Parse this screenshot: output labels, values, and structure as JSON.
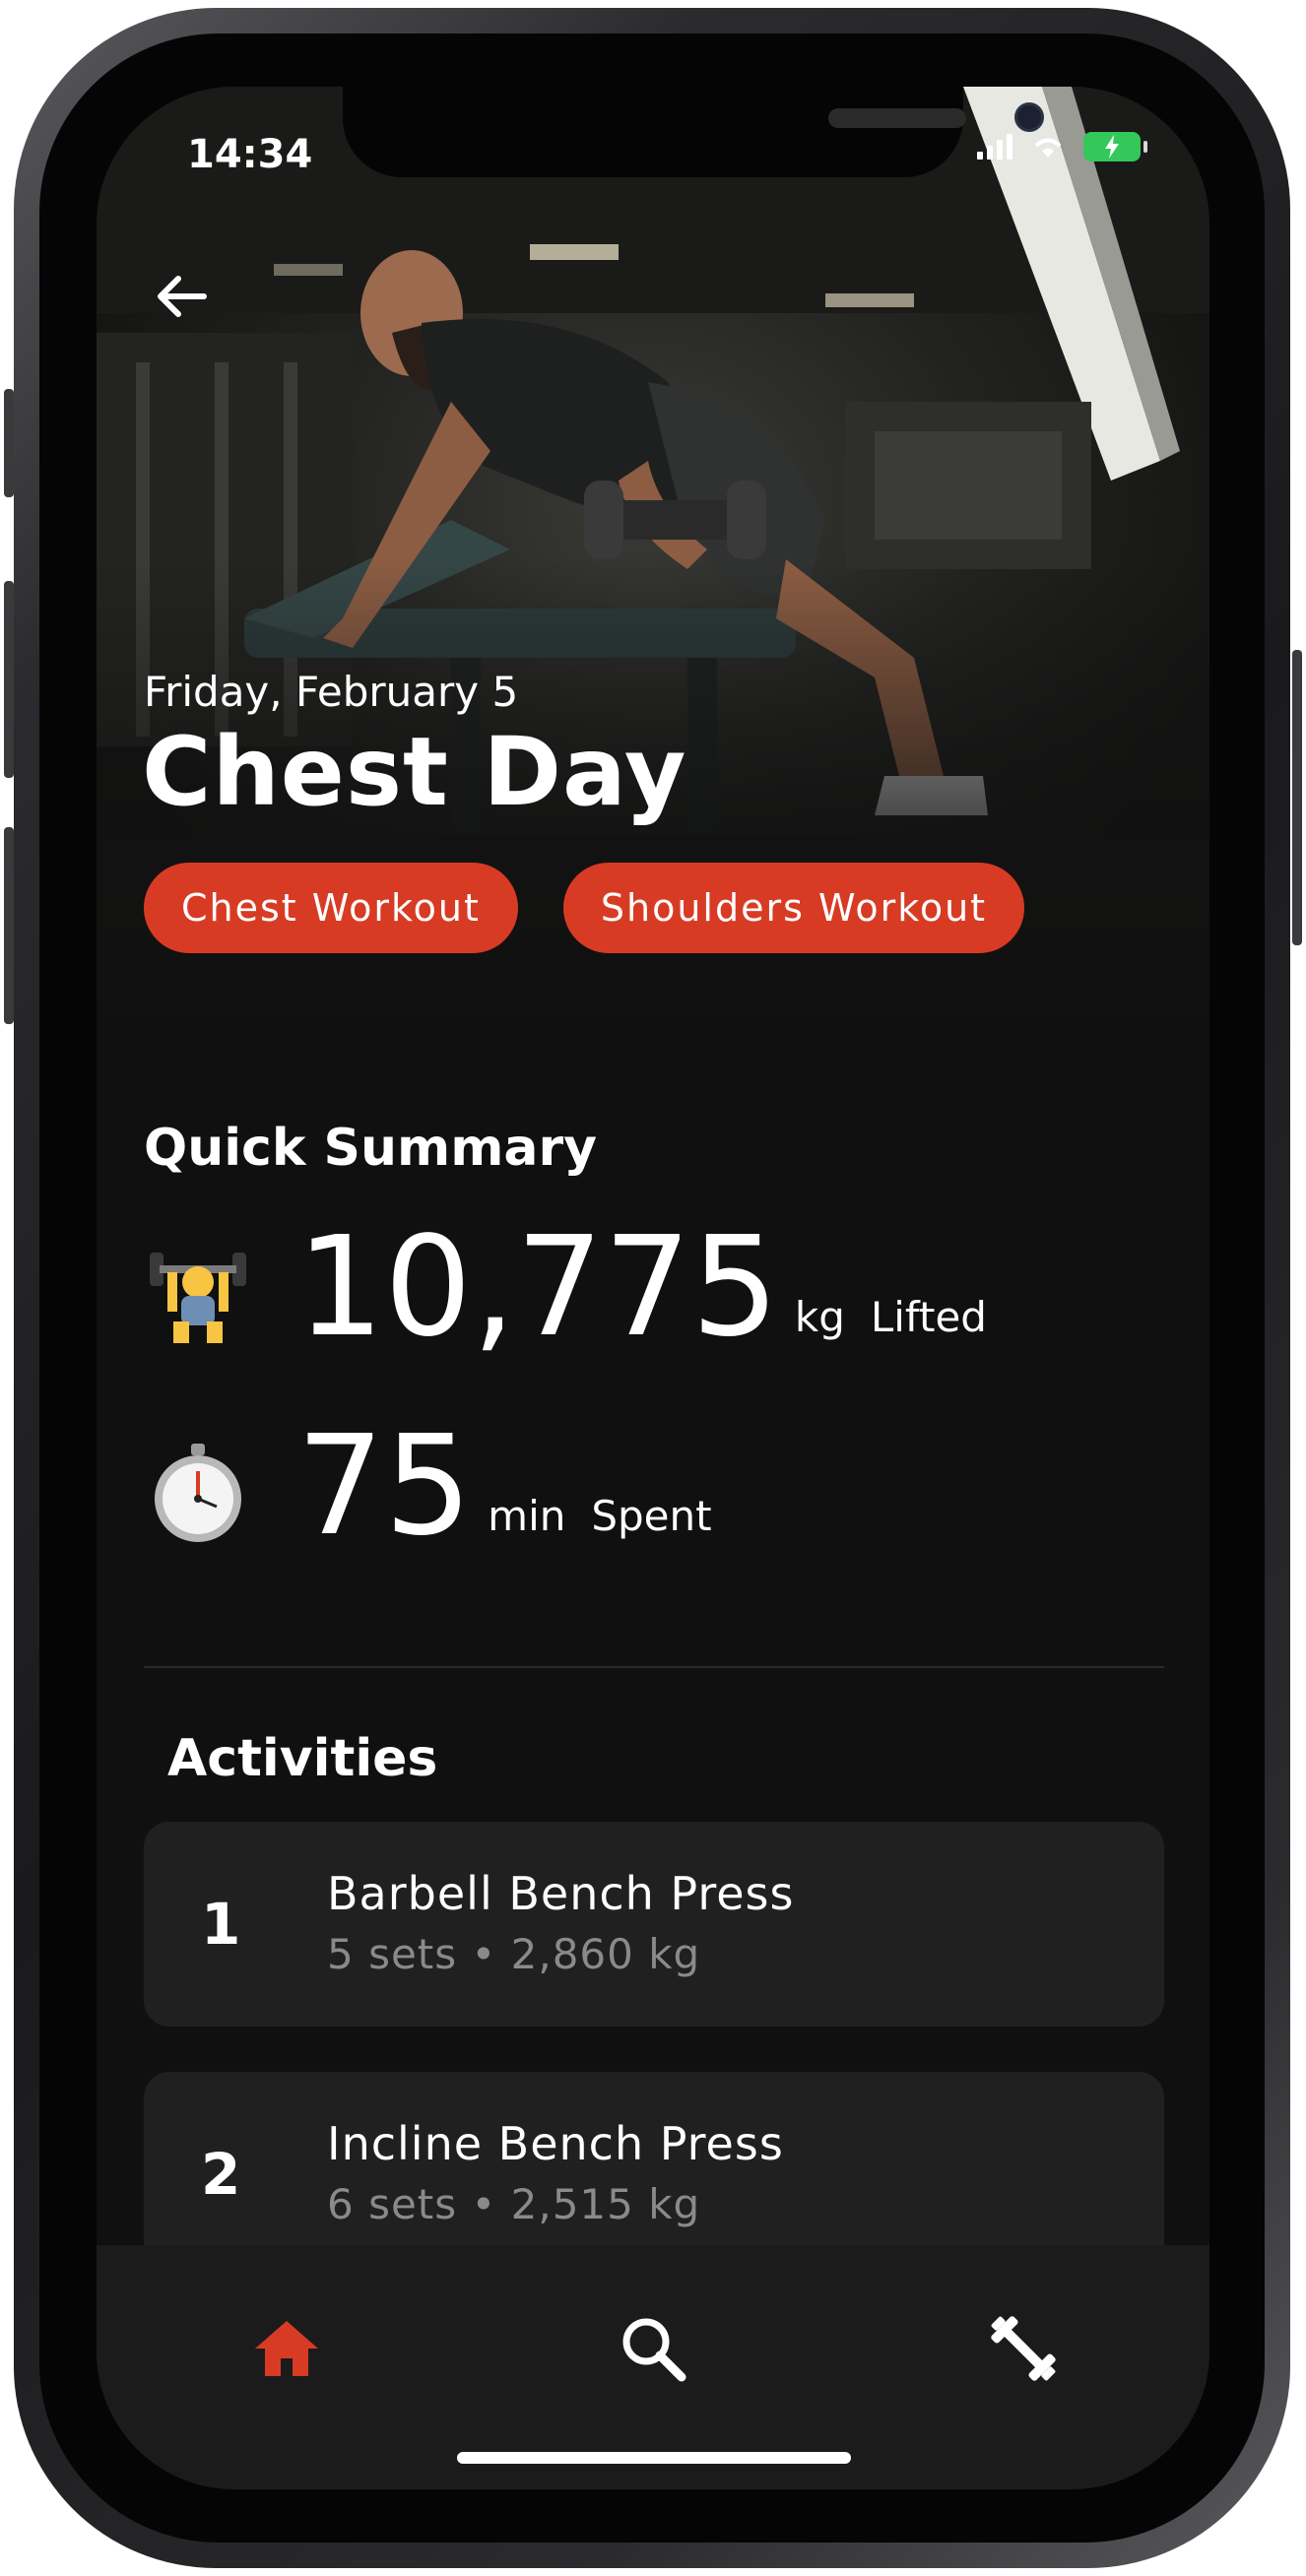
{
  "status": {
    "time": "14:34"
  },
  "header": {
    "date": "Friday, February 5",
    "title": "Chest Day",
    "tags": [
      "Chest Workout",
      "Shoulders Workout"
    ]
  },
  "summary": {
    "title": "Quick Summary",
    "lifted": {
      "value": "10,775",
      "unit": "kg",
      "label": "Lifted"
    },
    "time": {
      "value": "75",
      "unit": "min",
      "label": "Spent"
    }
  },
  "activities": {
    "title": "Activities",
    "items": [
      {
        "num": "1",
        "name": "Barbell Bench Press",
        "meta": "5 sets  • 2,860 kg"
      },
      {
        "num": "2",
        "name": "Incline Bench Press",
        "meta": "6 sets  • 2,515 kg"
      }
    ]
  },
  "tabs": [
    "home-icon",
    "search-icon",
    "dumbbell-icon"
  ],
  "colors": {
    "accent": "#d83b24",
    "background": "#101010",
    "card": "#202021",
    "battery": "#34c759"
  }
}
